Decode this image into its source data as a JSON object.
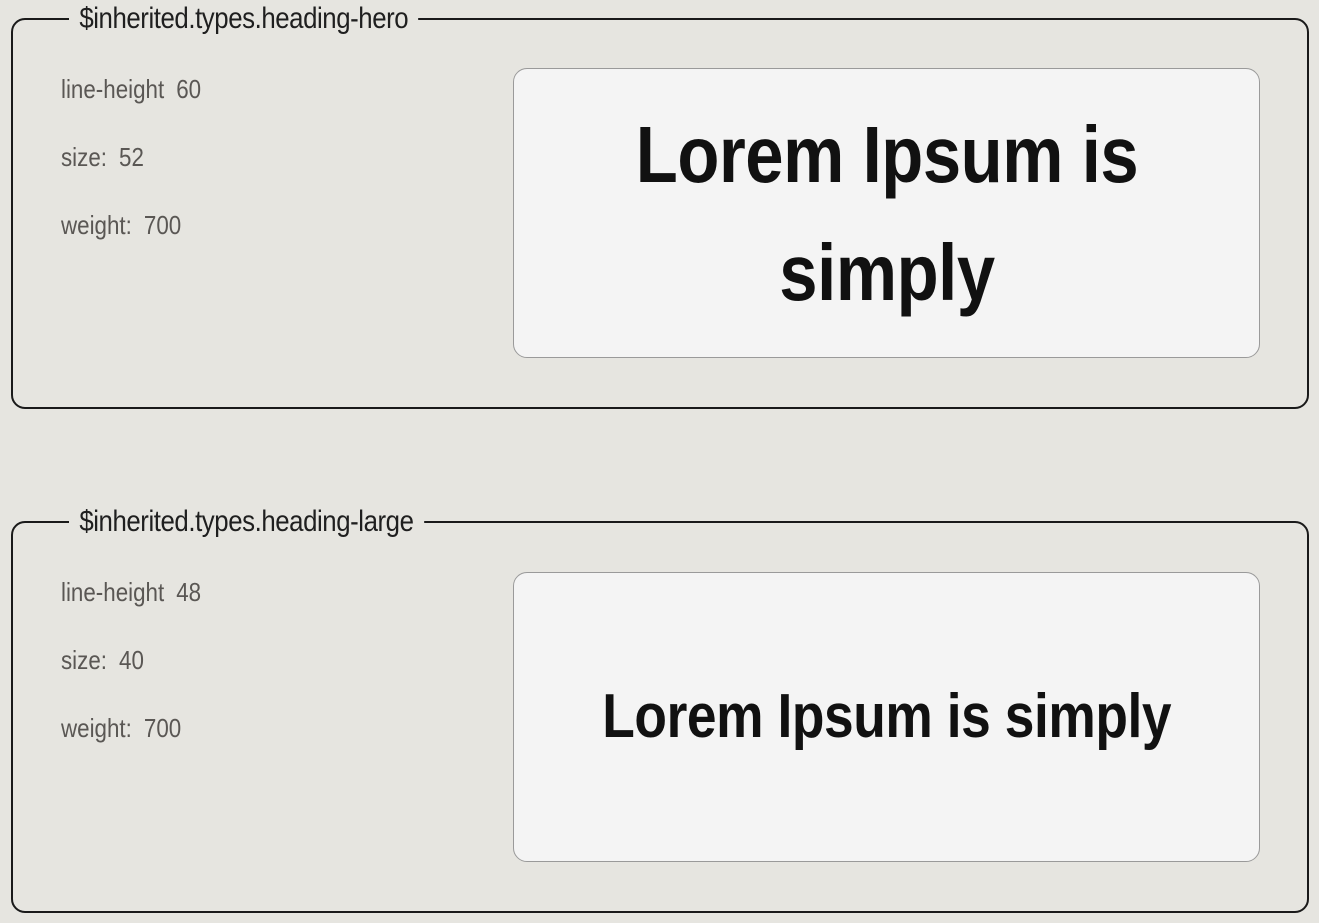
{
  "panels": [
    {
      "title": "$inherited.types.heading-hero",
      "properties": [
        {
          "key": "line-height",
          "value": "60"
        },
        {
          "key": "size:",
          "value": "52"
        },
        {
          "key": "weight:",
          "value": "700"
        }
      ],
      "preview_text": "Lorem Ipsum is simply"
    },
    {
      "title": "$inherited.types.heading-large",
      "properties": [
        {
          "key": "line-height",
          "value": "48"
        },
        {
          "key": "size:",
          "value": "40"
        },
        {
          "key": "weight:",
          "value": "700"
        }
      ],
      "preview_text": "Lorem Ipsum is simply"
    }
  ],
  "colors": {
    "background": "#e6e5e0",
    "panel_border": "#1a1a1a",
    "preview_background": "#f4f4f4",
    "preview_border": "#9a9a9a",
    "label_text": "#5a5754",
    "heading_text": "#111111"
  }
}
